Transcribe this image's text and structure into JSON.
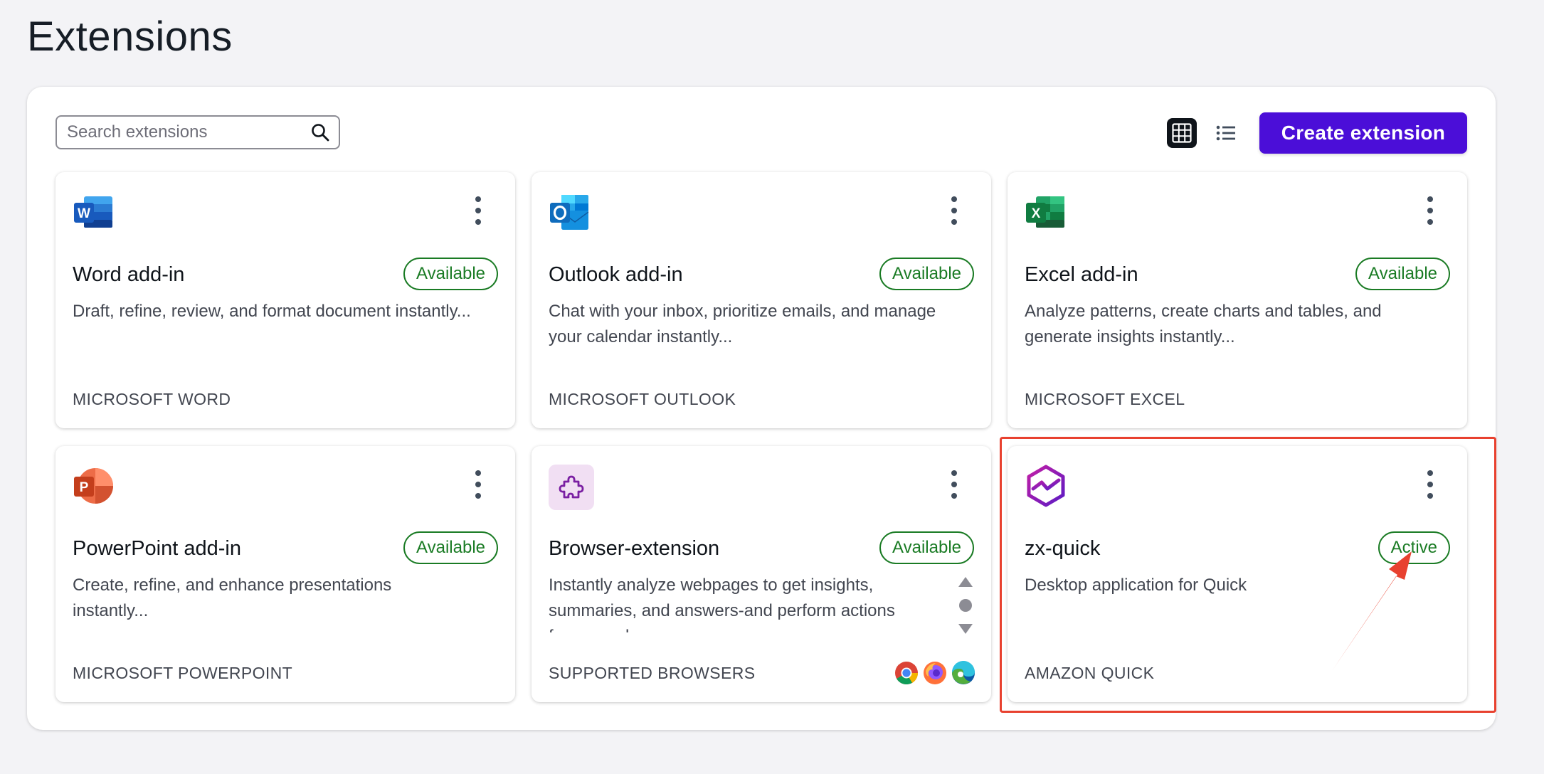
{
  "page": {
    "title": "Extensions"
  },
  "toolbar": {
    "search_placeholder": "Search extensions",
    "search_value": "",
    "create_label": "Create extension",
    "grid_view_icon": "grid-icon",
    "list_view_icon": "list-icon",
    "accent_color": "#4b0ed8"
  },
  "cards": [
    {
      "title": "Word add-in",
      "status": "Available",
      "description": "Draft, refine, review, and format document instantly...",
      "footer": "MICROSOFT WORD",
      "icon": "word-icon"
    },
    {
      "title": "Outlook add-in",
      "status": "Available",
      "description": "Chat with your inbox, prioritize emails, and manage your calendar instantly...",
      "footer": "MICROSOFT OUTLOOK",
      "icon": "outlook-icon"
    },
    {
      "title": "Excel add-in",
      "status": "Available",
      "description": "Analyze patterns, create charts and tables, and generate insights instantly...",
      "footer": "MICROSOFT EXCEL",
      "icon": "excel-icon"
    },
    {
      "title": "PowerPoint add-in",
      "status": "Available",
      "description": "Create, refine, and enhance presentations instantly...",
      "footer": "MICROSOFT POWERPOINT",
      "icon": "powerpoint-icon"
    },
    {
      "title": "Browser-extension",
      "status": "Available",
      "description": "Instantly analyze webpages to get insights, summaries, and answers-and perform actions from your browser",
      "footer": "SUPPORTED BROWSERS",
      "icon": "puzzle-piece-icon",
      "browsers": [
        "chrome-icon",
        "firefox-icon",
        "edge-icon"
      ]
    },
    {
      "title": "zx-quick",
      "status": "Active",
      "description": "Desktop application for Quick",
      "footer": "AMAZON QUICK",
      "icon": "quick-logo-icon"
    }
  ],
  "colors": {
    "status_green": "#1a7b24",
    "highlight_red": "#e8412f"
  }
}
